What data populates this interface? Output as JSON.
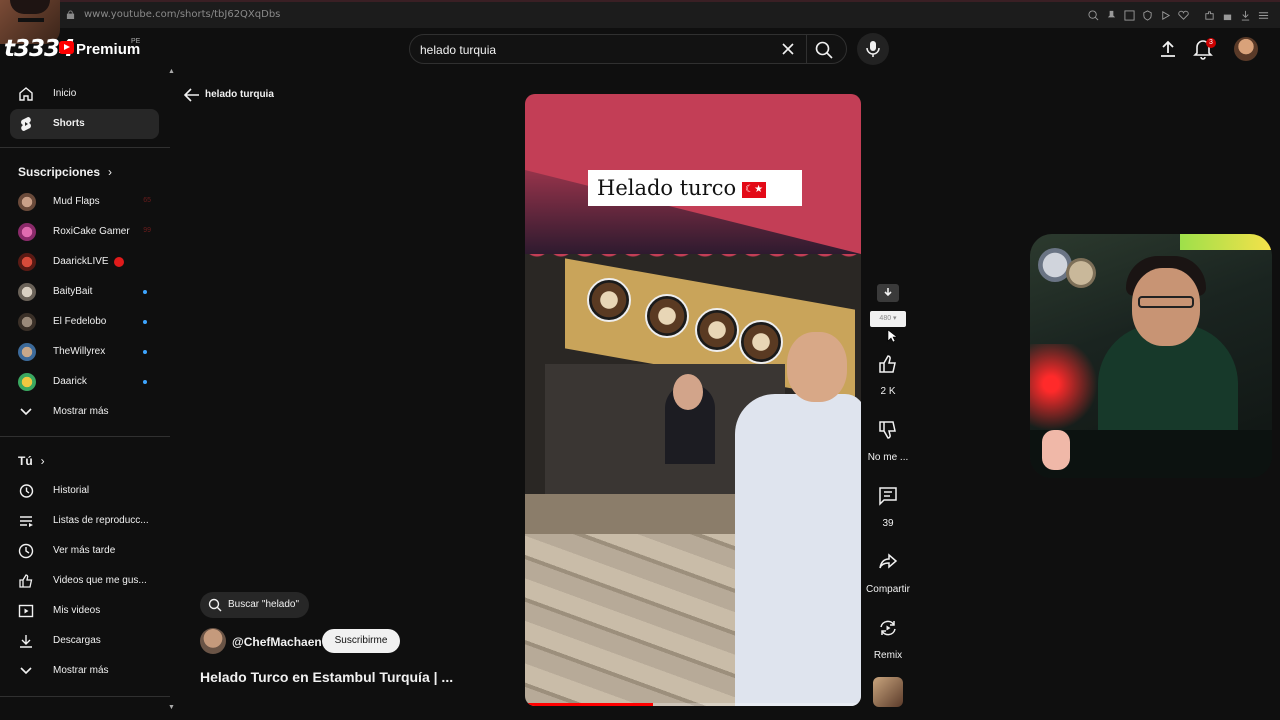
{
  "browser": {
    "url": "www.youtube.com/shorts/tbJ62QXqDbs"
  },
  "header": {
    "logo_text": "t3334",
    "premium": "Premium",
    "country": "PE",
    "search_query": "helado turquia",
    "notifications_count": "3"
  },
  "sidebar": {
    "main": [
      {
        "label": "Inicio",
        "icon": "home-icon"
      },
      {
        "label": "Shorts",
        "icon": "shorts-icon",
        "active": true
      }
    ],
    "subscriptions_title": "Suscripciones",
    "subscriptions": [
      {
        "label": "Mud Flaps",
        "count": "65"
      },
      {
        "label": "RoxiCake Gamer",
        "count": "99"
      },
      {
        "label": "DaarickLIVE",
        "live": true
      },
      {
        "label": "BaityBait"
      },
      {
        "label": "El Fedelobo"
      },
      {
        "label": "TheWillyrex"
      },
      {
        "label": "Daarick"
      }
    ],
    "show_more_1": "Mostrar más",
    "you_title": "Tú",
    "you": [
      {
        "label": "Historial",
        "icon": "history-icon"
      },
      {
        "label": "Listas de reproducc...",
        "icon": "playlist-icon"
      },
      {
        "label": "Ver más tarde",
        "icon": "clock-icon"
      },
      {
        "label": "Videos que me gus...",
        "icon": "thumbs-up-icon"
      },
      {
        "label": "Mis videos",
        "icon": "my-videos-icon"
      },
      {
        "label": "Descargas",
        "icon": "download-icon"
      }
    ],
    "show_more_2": "Mostrar más"
  },
  "main": {
    "back_label": "helado turquia",
    "video_overlay_title": "Helado turco",
    "search_chip": "Buscar \"helado\"",
    "channel_name": "@ChefMachaen",
    "subscribe": "Suscribirme",
    "video_title": "Helado Turco en Estambul Turquía | ...",
    "progress": 0.38,
    "quality": "480"
  },
  "actions": {
    "likes": "2 K",
    "dislike": "No me ...",
    "comments": "39",
    "share": "Compartir",
    "remix": "Remix"
  },
  "colors": {
    "accent": "#ff0000",
    "bg": "#0f0f0f",
    "live": "#e01b1b",
    "dot": "#3ea6ff"
  }
}
